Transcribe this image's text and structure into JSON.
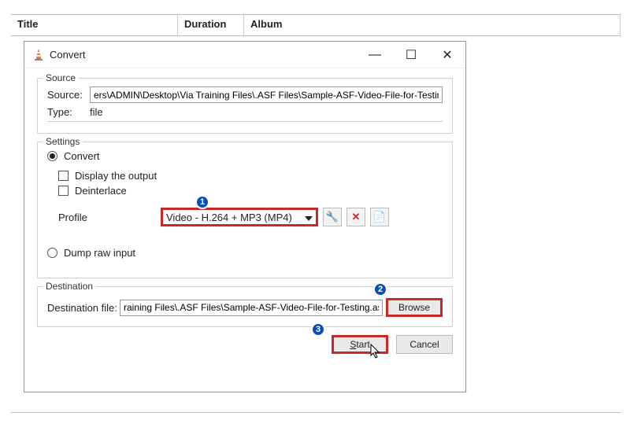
{
  "columns": {
    "title": "Title",
    "duration": "Duration",
    "album": "Album"
  },
  "dialog": {
    "title": "Convert",
    "win": {
      "min": "—",
      "max": "☐",
      "close": "✕"
    },
    "source": {
      "group": "Source",
      "label": "Source:",
      "value": "ers\\ADMIN\\Desktop\\Via Training Files\\.ASF Files\\Sample-ASF-Video-File-for-Testing.asf",
      "type_label": "Type:",
      "type_value": "file"
    },
    "settings": {
      "group": "Settings",
      "convert": "Convert",
      "display_output": "Display the output",
      "deinterlace": "Deinterlace",
      "profile_label": "Profile",
      "profile_value": "Video - H.264 + MP3 (MP4)",
      "icon_wrench": "🔧",
      "icon_delete": "✕",
      "icon_new": "📄",
      "dump_raw": "Dump raw input"
    },
    "destination": {
      "group": "Destination",
      "label": "Destination file:",
      "value": "raining Files\\.ASF Files\\Sample-ASF-Video-File-for-Testing.asf",
      "browse": "Browse"
    },
    "actions": {
      "start": "Start",
      "cancel": "Cancel"
    }
  },
  "badges": {
    "one": "1",
    "two": "2",
    "three": "3"
  }
}
